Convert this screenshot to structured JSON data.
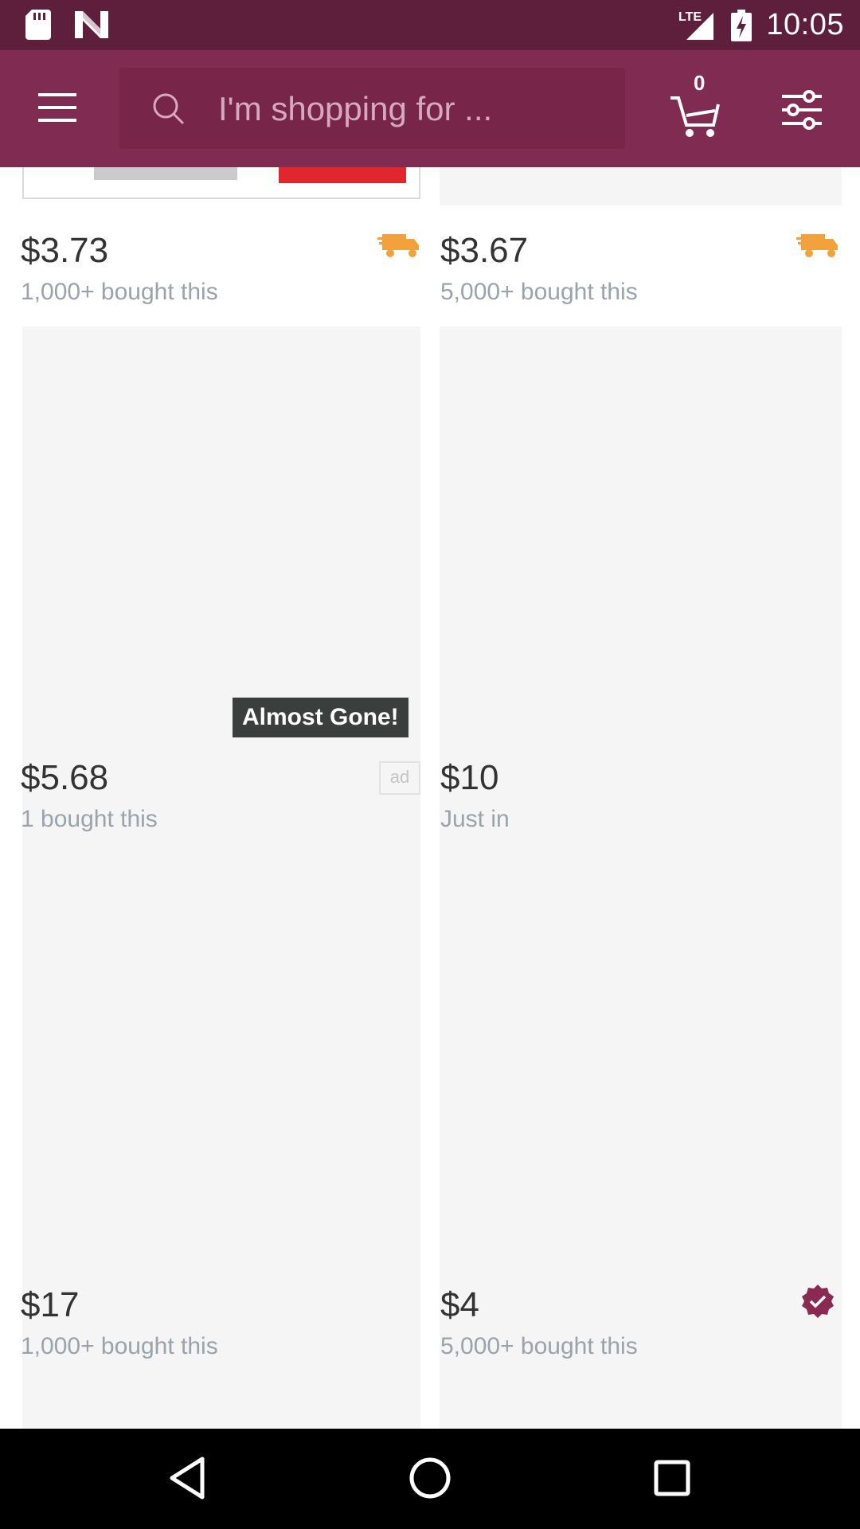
{
  "statusbar": {
    "time": "10:05",
    "network": "LTE",
    "icons": [
      "sd-card-icon",
      "n-logo-icon",
      "signal-icon",
      "battery-charging-icon"
    ]
  },
  "appbar": {
    "search_placeholder": "I'm shopping for ...",
    "cart_count": "0",
    "colors": {
      "appbar": "#7f2b52",
      "statusbar": "#5e1f3c"
    }
  },
  "products": [
    {
      "price": "$3.73",
      "sub": "1,000+ bought this",
      "free_shipping": true
    },
    {
      "price": "$3.67",
      "sub": "5,000+ bought this",
      "free_shipping": true
    },
    {
      "price": "$5.68",
      "sub": "1 bought this",
      "badge": "Almost Gone!",
      "ad": "ad"
    },
    {
      "price": "$10",
      "sub": "Just in"
    },
    {
      "price": "$17",
      "sub": "1,000+ bought this"
    },
    {
      "price": "$4",
      "sub": "5,000+ bought this",
      "verified": true
    }
  ],
  "colors": {
    "shipping_orange": "#f2a23c",
    "verified_badge": "#8a2a52",
    "price_text": "#333333",
    "sub_text": "#9aa3ab"
  }
}
